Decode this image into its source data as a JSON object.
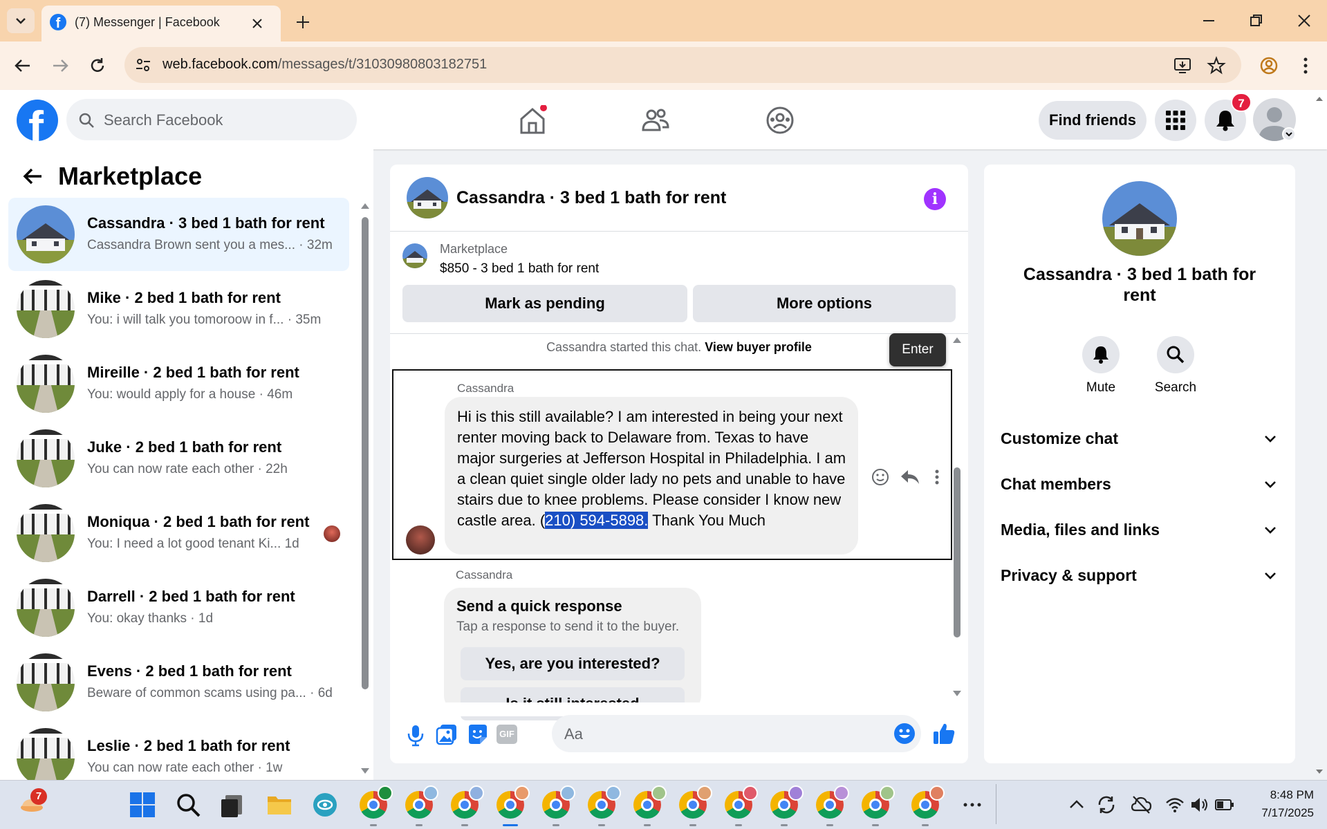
{
  "browser": {
    "tab_title": "(7) Messenger | Facebook",
    "url_domain": "web.facebook.com",
    "url_path": "/messages/t/31030980803182751"
  },
  "fb": {
    "search_placeholder": "Search Facebook",
    "find_friends": "Find friends",
    "notification_count": "7",
    "brand_color": "#1877f2"
  },
  "sidebar": {
    "title": "Marketplace",
    "conversations": [
      {
        "title": "Cassandra · 3 bed 1 bath for rent",
        "preview": "Cassandra Brown sent you a mes...",
        "time": "· 32m"
      },
      {
        "title": "Mike · 2 bed 1 bath for rent",
        "preview": "You: i will talk you tomoroow in f...",
        "time": "· 35m"
      },
      {
        "title": "Mireille · 2 bed 1 bath for rent",
        "preview": "You: would apply for a house",
        "time": "· 46m"
      },
      {
        "title": "Juke · 2 bed 1 bath for rent",
        "preview": "You can now rate each other",
        "time": "· 22h"
      },
      {
        "title": "Moniqua · 2 bed 1 bath for rent",
        "preview": "You: I need a lot good tenant Ki...",
        "time": "1d"
      },
      {
        "title": "Darrell · 2 bed 1 bath for rent",
        "preview": "You: okay thanks",
        "time": "· 1d"
      },
      {
        "title": "Evens · 2 bed 1 bath for rent",
        "preview": "Beware of common scams using pa...",
        "time": "· 6d"
      },
      {
        "title": "Leslie · 2 bed 1 bath for rent",
        "preview": "You can now rate each other",
        "time": "· 1w"
      }
    ]
  },
  "chat": {
    "header_title": "Cassandra · 3 bed 1 bath for rent",
    "listing_source": "Marketplace",
    "listing_title": "$850 - 3 bed 1 bath for rent",
    "mark_pending": "Mark as pending",
    "more_options": "More options",
    "started_text": "Cassandra started this chat.",
    "view_profile": "View buyer profile",
    "tooltip": "Enter",
    "sender": "Cassandra",
    "message_before": "Hi is this still available? I am interested in being your next renter moving back to Delaware from. Texas to have major surgeries at Jefferson Hospital in Philadelphia. I am a clean quiet single older lady no pets and unable to have stairs due to knee problems. Please consider I know new castle area. (",
    "message_highlight": "210) 594-5898.",
    "message_after": " Thank You Much",
    "sender2": "Cassandra",
    "quick_title": "Send a quick response",
    "quick_sub": "Tap a response to send it to the buyer.",
    "quick_option": "Yes, are you interested?",
    "quick_option2": "Is it still interested",
    "composer_placeholder": "Aa"
  },
  "info": {
    "title": "Cassandra · 3 bed 1 bath for rent",
    "mute": "Mute",
    "search": "Search",
    "sections": [
      "Customize chat",
      "Chat members",
      "Media, files and links",
      "Privacy & support"
    ]
  },
  "taskbar": {
    "badge": "7",
    "time": "8:48 PM",
    "date": "7/17/2025"
  }
}
